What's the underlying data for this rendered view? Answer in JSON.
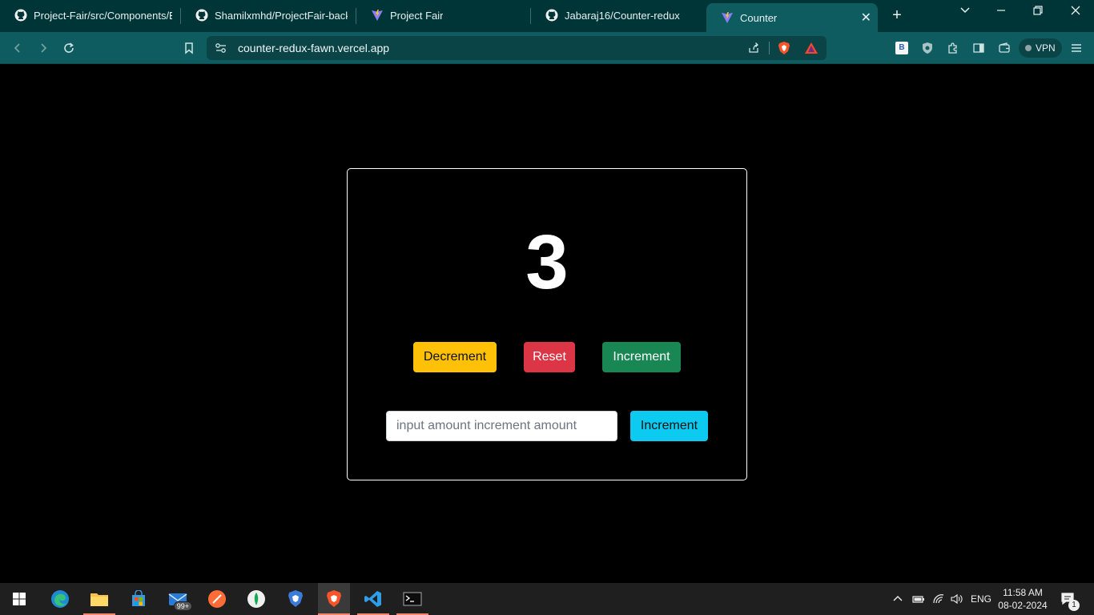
{
  "browser": {
    "tabs": [
      {
        "title": "Project-Fair/src/Components/Edi",
        "icon": "github-icon"
      },
      {
        "title": "Shamilxmhd/ProjectFair-backend",
        "icon": "github-icon"
      },
      {
        "title": "Project Fair",
        "icon": "vite-icon"
      },
      {
        "title": "Jabaraj16/Counter-redux",
        "icon": "github-icon"
      },
      {
        "title": "Counter",
        "icon": "vite-icon",
        "active": true
      }
    ],
    "url": "counter-redux-fawn.vercel.app",
    "vpn_label": "VPN",
    "ext_badge_label": "B",
    "colors": {
      "tabbar": "#003538",
      "toolbar": "#0f5c60"
    }
  },
  "counter": {
    "value": "3",
    "decrement_label": "Decrement",
    "reset_label": "Reset",
    "increment_label": "Increment",
    "amount_placeholder": "input amount increment amount",
    "increment_amount_label": "Increment",
    "colors": {
      "decrement": "#ffc107",
      "reset": "#dc3545",
      "increment": "#198754",
      "increment_amount": "#0dcaf0"
    }
  },
  "taskbar": {
    "apps": [
      "windows-start-icon",
      "edge-icon",
      "file-explorer-icon",
      "microsoft-store-icon",
      "mail-icon",
      "postman-icon",
      "mongodb-compass-icon",
      "brave-nightly-icon",
      "brave-icon",
      "vscode-icon",
      "terminal-icon"
    ],
    "mail_badge": "99+",
    "language": "ENG",
    "time": "11:58 AM",
    "date": "08-02-2024",
    "notification_count": "1"
  }
}
